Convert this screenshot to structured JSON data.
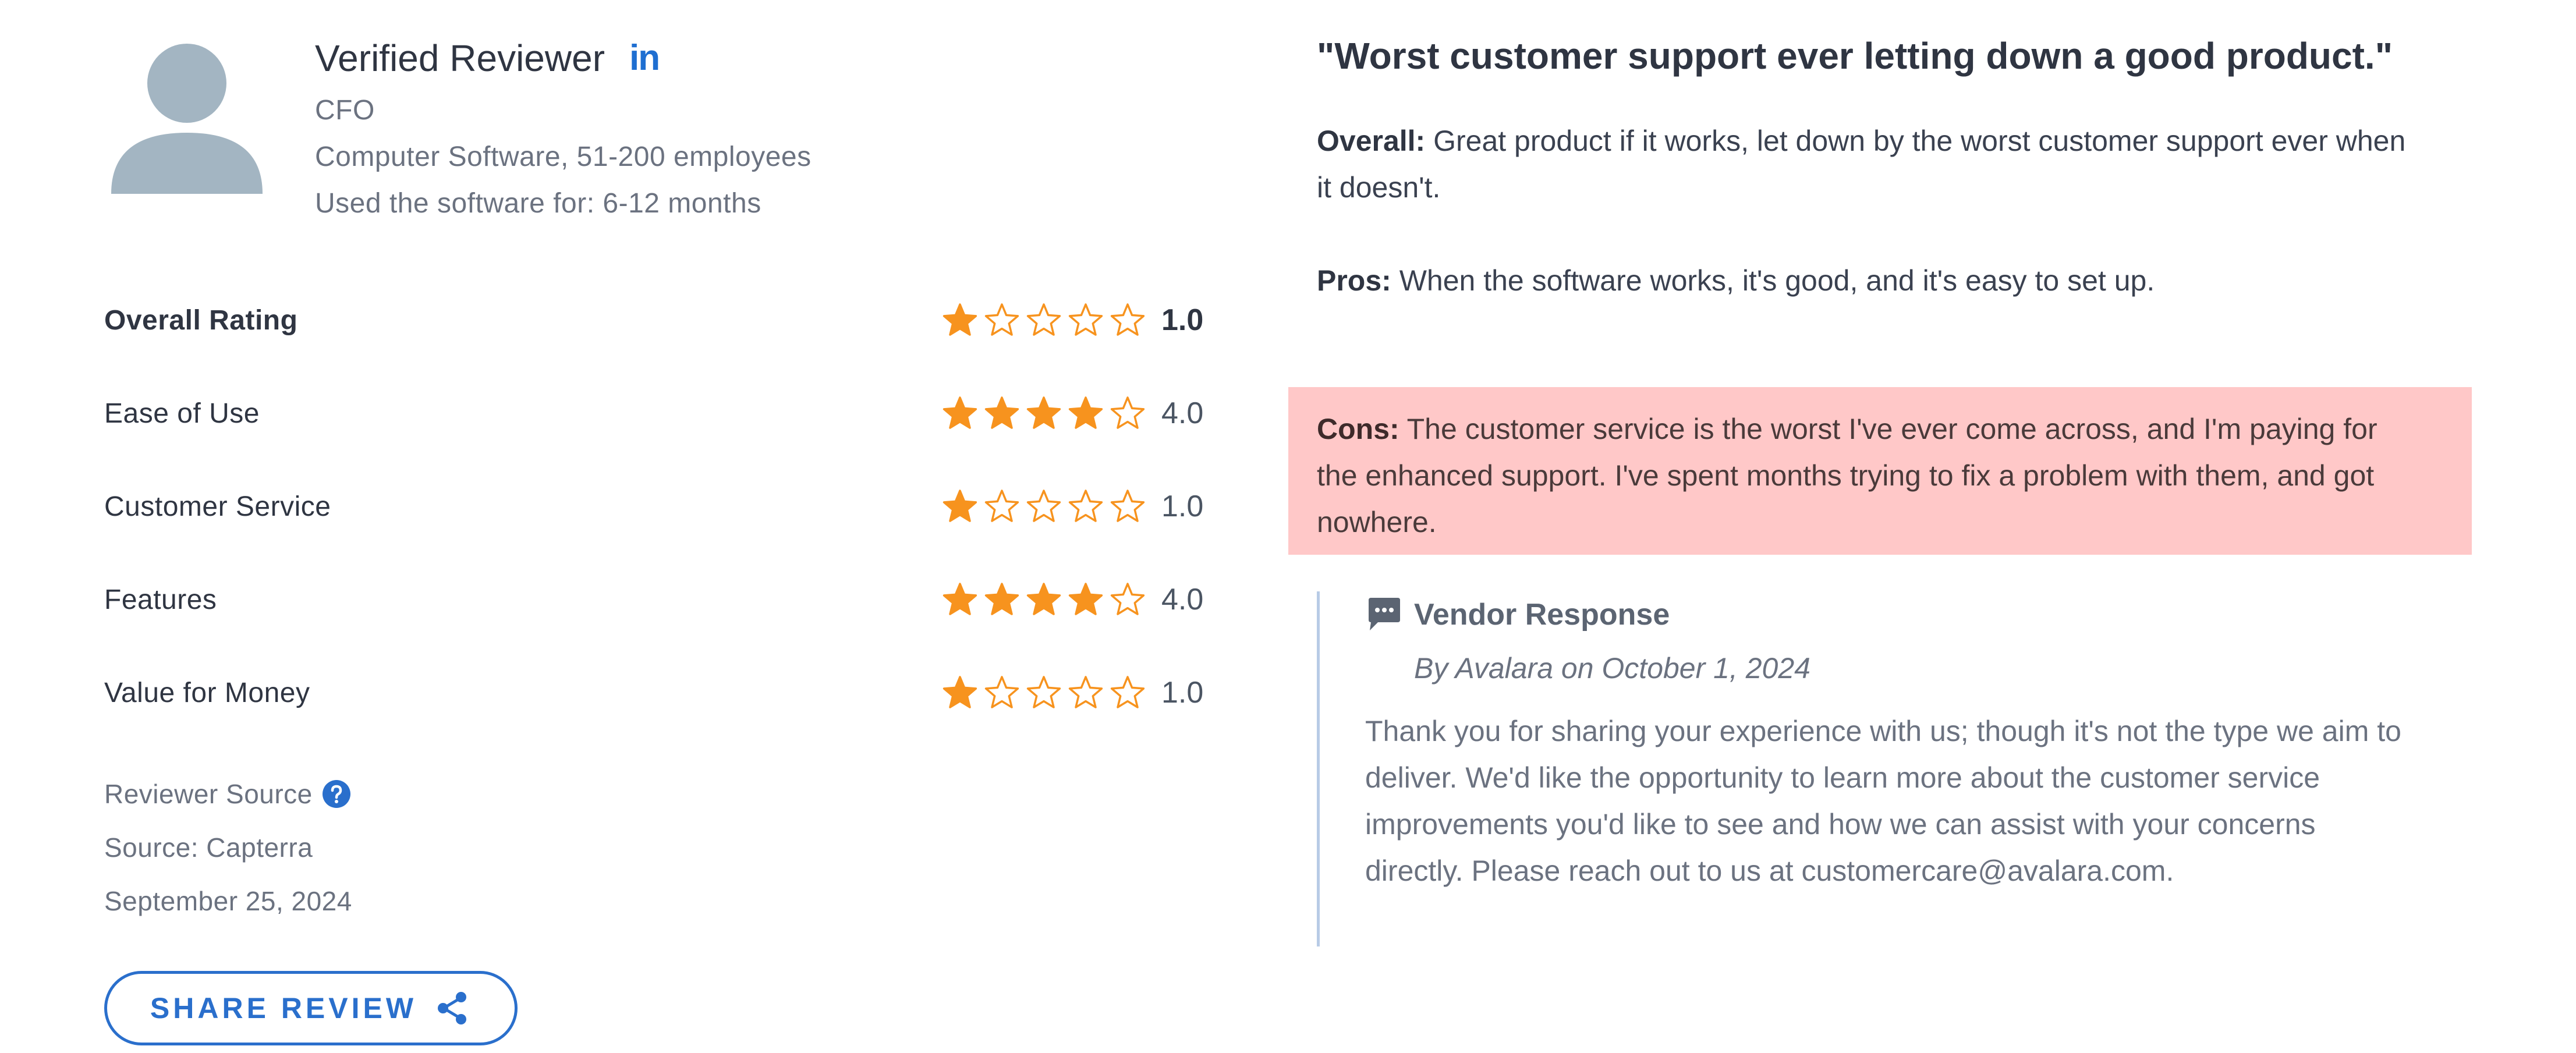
{
  "reviewer": {
    "name": "Verified Reviewer",
    "linkedin_label": "in",
    "role": "CFO",
    "company": "Computer Software, 51-200 employees",
    "usage": "Used the software for: 6-12 months"
  },
  "ratings": [
    {
      "label": "Overall Rating",
      "value": "1.0",
      "stars": 1
    },
    {
      "label": "Ease of Use",
      "value": "4.0",
      "stars": 4
    },
    {
      "label": "Customer Service",
      "value": "1.0",
      "stars": 1
    },
    {
      "label": "Features",
      "value": "4.0",
      "stars": 4
    },
    {
      "label": "Value for Money",
      "value": "1.0",
      "stars": 1
    }
  ],
  "source": {
    "label": "Reviewer Source",
    "source_text": "Source: Capterra",
    "date": "September 25, 2024"
  },
  "share": {
    "label": "SHARE REVIEW"
  },
  "review": {
    "title": "\"Worst customer support ever letting down a good product.\"",
    "overall_label": "Overall:",
    "overall_text": " Great product if it works, let down by the worst customer support ever when it doesn't.",
    "pros_label": "Pros:",
    "pros_text": " When the software works, it's good, and it's easy to set up.",
    "cons_label": "Cons:",
    "cons_text": " The customer service is the worst I've ever come across, and I'm paying for the enhanced support. I've spent months trying to fix a problem with them, and got nowhere."
  },
  "vendor_response": {
    "title": "Vendor Response",
    "byline": "By Avalara on October 1, 2024",
    "body": "Thank you for sharing your experience with us; though it's not the type we aim to deliver. We'd like the opportunity to learn more about the customer service improvements you'd like to see and how we can assist with your concerns directly. Please reach out to us at customercare@avalara.com."
  },
  "colors": {
    "star": "#f7931e",
    "accent_blue": "#2a6fcc",
    "cons_highlight": "#ffc8c8",
    "avatar": "#a3b5c2"
  },
  "icons": {
    "avatar": "person-icon",
    "linkedin": "linkedin-icon",
    "help": "question-icon",
    "share": "share-icon",
    "vendor": "chat-bubble-icon",
    "star_filled": "star-filled-icon",
    "star_empty": "star-outline-icon"
  }
}
